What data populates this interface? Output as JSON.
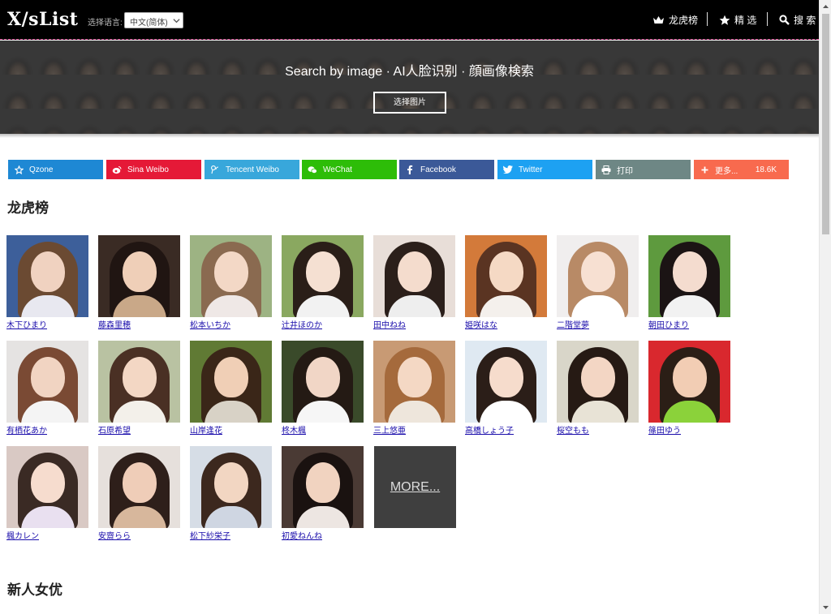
{
  "header": {
    "logo": "X/sList",
    "lang_label": "选择语言:",
    "lang_value": "中文(简体)",
    "nav": [
      {
        "label": "龙虎榜",
        "icon": "crown-icon"
      },
      {
        "label": "精 选",
        "icon": "star-icon"
      },
      {
        "label": "搜 索",
        "icon": "search-icon"
      }
    ]
  },
  "banner": {
    "title": "Search by image · AI人脸识别 · 顔画像検索",
    "button": "选择图片"
  },
  "share": [
    {
      "label": "Qzone",
      "color": "#1e88d4",
      "icon": "qzone-star-icon"
    },
    {
      "label": "Sina Weibo",
      "color": "#e51937",
      "icon": "weibo-icon"
    },
    {
      "label": "Tencent Weibo",
      "color": "#38a7db",
      "icon": "tencent-weibo-icon"
    },
    {
      "label": "WeChat",
      "color": "#2dbd08",
      "icon": "wechat-icon"
    },
    {
      "label": "Facebook",
      "color": "#3b5998",
      "icon": "facebook-icon"
    },
    {
      "label": "Twitter",
      "color": "#1da1f2",
      "icon": "twitter-icon"
    },
    {
      "label": "打印",
      "color": "#6e8785",
      "icon": "printer-icon"
    },
    {
      "label": "更多...",
      "color": "#f86a4e",
      "icon": "plus-icon",
      "count": "18.6K"
    }
  ],
  "sections": {
    "ranking_title": "龙虎榜",
    "newcomer_title": "新人女优"
  },
  "actresses": [
    {
      "name": "木下ひまり",
      "bg": "#3d5f9a",
      "hair": "#6b4a32",
      "skin": "#f0d2c0",
      "top": "#e8e8f0"
    },
    {
      "name": "藤森里穂",
      "bg": "#3a2b24",
      "hair": "#201512",
      "skin": "#efcfb8",
      "top": "#c9a888"
    },
    {
      "name": "松本いちか",
      "bg": "#9db383",
      "hair": "#8a6a50",
      "skin": "#f3d8c6",
      "top": "#efe8e6"
    },
    {
      "name": "辻井ほのか",
      "bg": "#8aa860",
      "hair": "#2a1e18",
      "skin": "#f5e0d2",
      "top": "#f2f2f2"
    },
    {
      "name": "田中ねね",
      "bg": "#e8ded8",
      "hair": "#2b1f1a",
      "skin": "#f4dccd",
      "top": "#eeeeee"
    },
    {
      "name": "姫咲はな",
      "bg": "#d37a3a",
      "hair": "#5a3422",
      "skin": "#f5d9c4",
      "top": "#f4f0ec"
    },
    {
      "name": "二階堂夢",
      "bg": "#f0eeee",
      "hair": "#b88a66",
      "skin": "#f7e0d2",
      "top": "#ffffff"
    },
    {
      "name": "朝田ひまり",
      "bg": "#5e9a3e",
      "hair": "#1b1414",
      "skin": "#f4dccf",
      "top": "#f2f2f2"
    },
    {
      "name": "有栖花あか",
      "bg": "#e5e3e2",
      "hair": "#7a4a34",
      "skin": "#f1d4c2",
      "top": "#f4f4f4"
    },
    {
      "name": "石原希望",
      "bg": "#b9c2a2",
      "hair": "#4a3024",
      "skin": "#f3d7c4",
      "top": "#f3f0ea"
    },
    {
      "name": "山岸逢花",
      "bg": "#607a34",
      "hair": "#3a2618",
      "skin": "#f0cfb6",
      "top": "#d8d2c6"
    },
    {
      "name": "柊木楓",
      "bg": "#3a4a2a",
      "hair": "#241a14",
      "skin": "#f1d6c6",
      "top": "#f6f6f6"
    },
    {
      "name": "三上悠亜",
      "bg": "#c89a74",
      "hair": "#a56a3c",
      "skin": "#f4d8c4",
      "top": "#eee6dc"
    },
    {
      "name": "高橋しょう子",
      "bg": "#dfe9f2",
      "hair": "#2b1e18",
      "skin": "#f6dccc",
      "top": "#ffffff"
    },
    {
      "name": "桜空もも",
      "bg": "#d9d6c9",
      "hair": "#261a14",
      "skin": "#f3d6c4",
      "top": "#e8e3d6"
    },
    {
      "name": "篠田ゆう",
      "bg": "#d9282e",
      "hair": "#2b1e16",
      "skin": "#f2cdb4",
      "top": "#8bd23a"
    },
    {
      "name": "楓カレン",
      "bg": "#d9c9c4",
      "hair": "#3a2a24",
      "skin": "#f6dcce",
      "top": "#e9e0f0"
    },
    {
      "name": "安齋らら",
      "bg": "#e6e0dc",
      "hair": "#2e1f1a",
      "skin": "#efcdb8",
      "top": "#d7b79c"
    },
    {
      "name": "松下紗栄子",
      "bg": "#d6dde6",
      "hair": "#3c281e",
      "skin": "#f2d6c2",
      "top": "#cfd6e2"
    },
    {
      "name": "初愛ねんね",
      "bg": "#4a3a34",
      "hair": "#1a1210",
      "skin": "#f1d3c0",
      "top": "#ede6e2"
    }
  ],
  "more_label": "MORE..."
}
